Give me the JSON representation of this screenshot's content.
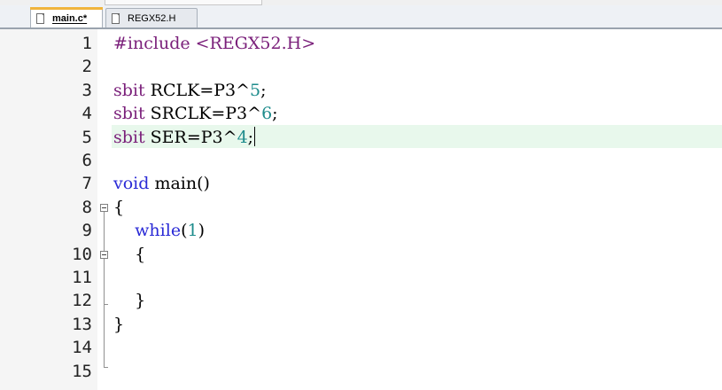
{
  "tabs": [
    {
      "label": "main.c*",
      "active": true
    },
    {
      "label": "REGX52.H",
      "active": false
    }
  ],
  "lines": [
    {
      "n": "1",
      "segments": [
        {
          "t": "#include <REGX52.H>",
          "c": "pp"
        }
      ]
    },
    {
      "n": "2",
      "segments": []
    },
    {
      "n": "3",
      "segments": [
        {
          "t": "sbit",
          "c": "pp"
        },
        {
          "t": " RCLK=P3^",
          "c": ""
        },
        {
          "t": "5",
          "c": "num"
        },
        {
          "t": ";",
          "c": ""
        }
      ]
    },
    {
      "n": "4",
      "segments": [
        {
          "t": "sbit",
          "c": "pp"
        },
        {
          "t": " SRCLK=P3^",
          "c": ""
        },
        {
          "t": "6",
          "c": "num"
        },
        {
          "t": ";",
          "c": ""
        }
      ]
    },
    {
      "n": "5",
      "segments": [
        {
          "t": "sbit",
          "c": "pp"
        },
        {
          "t": " SER=P3^",
          "c": ""
        },
        {
          "t": "4",
          "c": "num"
        },
        {
          "t": ";",
          "c": ""
        }
      ],
      "current": true
    },
    {
      "n": "6",
      "segments": []
    },
    {
      "n": "7",
      "segments": [
        {
          "t": "void",
          "c": "kw"
        },
        {
          "t": " main()",
          "c": ""
        }
      ]
    },
    {
      "n": "8",
      "segments": [
        {
          "t": "{",
          "c": ""
        }
      ]
    },
    {
      "n": "9",
      "segments": [
        {
          "t": "    ",
          "c": ""
        },
        {
          "t": "while",
          "c": "kw"
        },
        {
          "t": "(",
          "c": ""
        },
        {
          "t": "1",
          "c": "num"
        },
        {
          "t": ")",
          "c": ""
        }
      ]
    },
    {
      "n": "10",
      "segments": [
        {
          "t": "    {",
          "c": ""
        }
      ]
    },
    {
      "n": "11",
      "segments": []
    },
    {
      "n": "12",
      "segments": [
        {
          "t": "    }",
          "c": ""
        }
      ]
    },
    {
      "n": "13",
      "segments": [
        {
          "t": "}",
          "c": ""
        }
      ]
    },
    {
      "n": "14",
      "segments": []
    },
    {
      "n": "15",
      "segments": []
    }
  ],
  "editor": {
    "current_line_color": "#e8f8ec",
    "keyword_color": "#2a2ad6",
    "preprocessor_color": "#7a1f7a",
    "number_color": "#1e8c8c"
  }
}
